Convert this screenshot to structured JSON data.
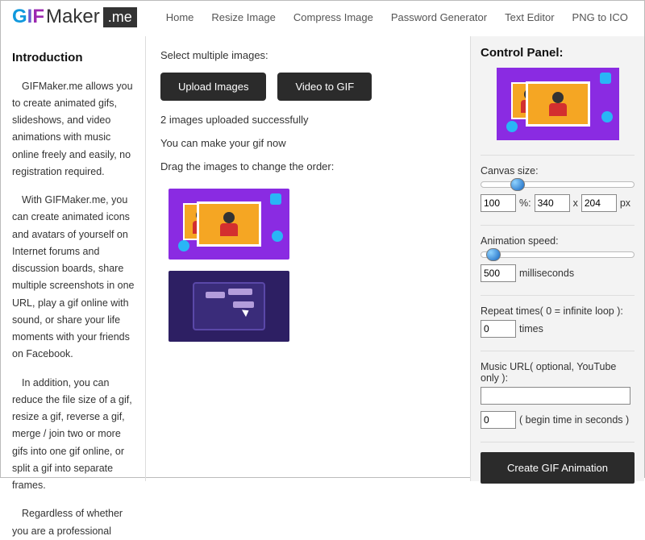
{
  "logo": {
    "gif": "GIF",
    "maker": "Maker",
    "me": ".me"
  },
  "nav": [
    "Home",
    "Resize Image",
    "Compress Image",
    "Password Generator",
    "Text Editor",
    "PNG to ICO"
  ],
  "intro": {
    "title": "Introduction",
    "p1": "GIFMaker.me allows you to create animated gifs, slideshows, and video animations with music online freely and easily, no registration required.",
    "p2": "With GIFMaker.me, you can create animated icons and avatars of yourself on Internet forums and discussion boards, share multiple screenshots in one URL, play a gif online with sound, or share your life moments with your friends on Facebook.",
    "p3": "In addition, you can reduce the file size of a gif, resize a gif, reverse a gif, merge / join two or more gifs into one gif online, or split a gif into separate frames.",
    "p4": "Regardless of whether you are a professional"
  },
  "center": {
    "select_label": "Select multiple images:",
    "upload_btn": "Upload Images",
    "video_btn": "Video to GIF",
    "status": "2 images uploaded successfully",
    "make_now": "You can make your gif now",
    "drag_label": "Drag the images to change the order:"
  },
  "panel": {
    "title": "Control Panel:",
    "canvas_label": "Canvas size:",
    "canvas_percent": "100",
    "canvas_percent_suffix": "%:",
    "canvas_w": "340",
    "canvas_x": "x",
    "canvas_h": "204",
    "canvas_px": "px",
    "speed_label": "Animation speed:",
    "speed_value": "500",
    "speed_unit": "milliseconds",
    "repeat_label": "Repeat times( 0 = infinite loop ):",
    "repeat_value": "0",
    "repeat_unit": "times",
    "music_label": "Music URL( optional, YouTube only ):",
    "music_value": "",
    "music_begin": "0",
    "music_begin_label": "( begin time in seconds )",
    "create_btn": "Create GIF Animation"
  }
}
